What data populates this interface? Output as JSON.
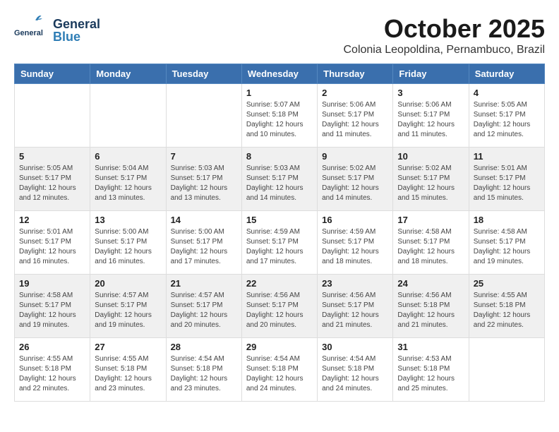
{
  "header": {
    "logo_general": "General",
    "logo_blue": "Blue",
    "month_year": "October 2025",
    "location": "Colonia Leopoldina, Pernambuco, Brazil"
  },
  "weekdays": [
    "Sunday",
    "Monday",
    "Tuesday",
    "Wednesday",
    "Thursday",
    "Friday",
    "Saturday"
  ],
  "weeks": [
    [
      {
        "day": "",
        "sunrise": "",
        "sunset": "",
        "daylight": ""
      },
      {
        "day": "",
        "sunrise": "",
        "sunset": "",
        "daylight": ""
      },
      {
        "day": "",
        "sunrise": "",
        "sunset": "",
        "daylight": ""
      },
      {
        "day": "1",
        "sunrise": "Sunrise: 5:07 AM",
        "sunset": "Sunset: 5:18 PM",
        "daylight": "Daylight: 12 hours and 10 minutes."
      },
      {
        "day": "2",
        "sunrise": "Sunrise: 5:06 AM",
        "sunset": "Sunset: 5:17 PM",
        "daylight": "Daylight: 12 hours and 11 minutes."
      },
      {
        "day": "3",
        "sunrise": "Sunrise: 5:06 AM",
        "sunset": "Sunset: 5:17 PM",
        "daylight": "Daylight: 12 hours and 11 minutes."
      },
      {
        "day": "4",
        "sunrise": "Sunrise: 5:05 AM",
        "sunset": "Sunset: 5:17 PM",
        "daylight": "Daylight: 12 hours and 12 minutes."
      }
    ],
    [
      {
        "day": "5",
        "sunrise": "Sunrise: 5:05 AM",
        "sunset": "Sunset: 5:17 PM",
        "daylight": "Daylight: 12 hours and 12 minutes."
      },
      {
        "day": "6",
        "sunrise": "Sunrise: 5:04 AM",
        "sunset": "Sunset: 5:17 PM",
        "daylight": "Daylight: 12 hours and 13 minutes."
      },
      {
        "day": "7",
        "sunrise": "Sunrise: 5:03 AM",
        "sunset": "Sunset: 5:17 PM",
        "daylight": "Daylight: 12 hours and 13 minutes."
      },
      {
        "day": "8",
        "sunrise": "Sunrise: 5:03 AM",
        "sunset": "Sunset: 5:17 PM",
        "daylight": "Daylight: 12 hours and 14 minutes."
      },
      {
        "day": "9",
        "sunrise": "Sunrise: 5:02 AM",
        "sunset": "Sunset: 5:17 PM",
        "daylight": "Daylight: 12 hours and 14 minutes."
      },
      {
        "day": "10",
        "sunrise": "Sunrise: 5:02 AM",
        "sunset": "Sunset: 5:17 PM",
        "daylight": "Daylight: 12 hours and 15 minutes."
      },
      {
        "day": "11",
        "sunrise": "Sunrise: 5:01 AM",
        "sunset": "Sunset: 5:17 PM",
        "daylight": "Daylight: 12 hours and 15 minutes."
      }
    ],
    [
      {
        "day": "12",
        "sunrise": "Sunrise: 5:01 AM",
        "sunset": "Sunset: 5:17 PM",
        "daylight": "Daylight: 12 hours and 16 minutes."
      },
      {
        "day": "13",
        "sunrise": "Sunrise: 5:00 AM",
        "sunset": "Sunset: 5:17 PM",
        "daylight": "Daylight: 12 hours and 16 minutes."
      },
      {
        "day": "14",
        "sunrise": "Sunrise: 5:00 AM",
        "sunset": "Sunset: 5:17 PM",
        "daylight": "Daylight: 12 hours and 17 minutes."
      },
      {
        "day": "15",
        "sunrise": "Sunrise: 4:59 AM",
        "sunset": "Sunset: 5:17 PM",
        "daylight": "Daylight: 12 hours and 17 minutes."
      },
      {
        "day": "16",
        "sunrise": "Sunrise: 4:59 AM",
        "sunset": "Sunset: 5:17 PM",
        "daylight": "Daylight: 12 hours and 18 minutes."
      },
      {
        "day": "17",
        "sunrise": "Sunrise: 4:58 AM",
        "sunset": "Sunset: 5:17 PM",
        "daylight": "Daylight: 12 hours and 18 minutes."
      },
      {
        "day": "18",
        "sunrise": "Sunrise: 4:58 AM",
        "sunset": "Sunset: 5:17 PM",
        "daylight": "Daylight: 12 hours and 19 minutes."
      }
    ],
    [
      {
        "day": "19",
        "sunrise": "Sunrise: 4:58 AM",
        "sunset": "Sunset: 5:17 PM",
        "daylight": "Daylight: 12 hours and 19 minutes."
      },
      {
        "day": "20",
        "sunrise": "Sunrise: 4:57 AM",
        "sunset": "Sunset: 5:17 PM",
        "daylight": "Daylight: 12 hours and 19 minutes."
      },
      {
        "day": "21",
        "sunrise": "Sunrise: 4:57 AM",
        "sunset": "Sunset: 5:17 PM",
        "daylight": "Daylight: 12 hours and 20 minutes."
      },
      {
        "day": "22",
        "sunrise": "Sunrise: 4:56 AM",
        "sunset": "Sunset: 5:17 PM",
        "daylight": "Daylight: 12 hours and 20 minutes."
      },
      {
        "day": "23",
        "sunrise": "Sunrise: 4:56 AM",
        "sunset": "Sunset: 5:17 PM",
        "daylight": "Daylight: 12 hours and 21 minutes."
      },
      {
        "day": "24",
        "sunrise": "Sunrise: 4:56 AM",
        "sunset": "Sunset: 5:18 PM",
        "daylight": "Daylight: 12 hours and 21 minutes."
      },
      {
        "day": "25",
        "sunrise": "Sunrise: 4:55 AM",
        "sunset": "Sunset: 5:18 PM",
        "daylight": "Daylight: 12 hours and 22 minutes."
      }
    ],
    [
      {
        "day": "26",
        "sunrise": "Sunrise: 4:55 AM",
        "sunset": "Sunset: 5:18 PM",
        "daylight": "Daylight: 12 hours and 22 minutes."
      },
      {
        "day": "27",
        "sunrise": "Sunrise: 4:55 AM",
        "sunset": "Sunset: 5:18 PM",
        "daylight": "Daylight: 12 hours and 23 minutes."
      },
      {
        "day": "28",
        "sunrise": "Sunrise: 4:54 AM",
        "sunset": "Sunset: 5:18 PM",
        "daylight": "Daylight: 12 hours and 23 minutes."
      },
      {
        "day": "29",
        "sunrise": "Sunrise: 4:54 AM",
        "sunset": "Sunset: 5:18 PM",
        "daylight": "Daylight: 12 hours and 24 minutes."
      },
      {
        "day": "30",
        "sunrise": "Sunrise: 4:54 AM",
        "sunset": "Sunset: 5:18 PM",
        "daylight": "Daylight: 12 hours and 24 minutes."
      },
      {
        "day": "31",
        "sunrise": "Sunrise: 4:53 AM",
        "sunset": "Sunset: 5:18 PM",
        "daylight": "Daylight: 12 hours and 25 minutes."
      },
      {
        "day": "",
        "sunrise": "",
        "sunset": "",
        "daylight": ""
      }
    ]
  ]
}
